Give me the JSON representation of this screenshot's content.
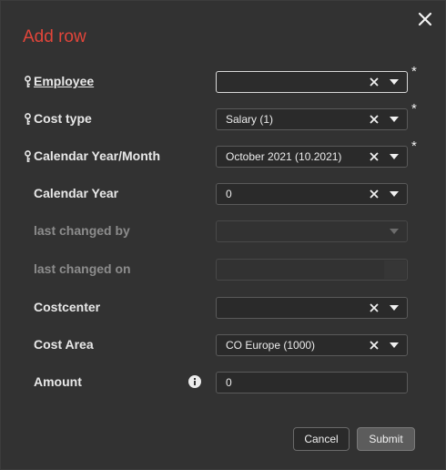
{
  "dialog": {
    "title": "Add row",
    "close_label": "×"
  },
  "fields": {
    "employee": {
      "label": "Employee",
      "value": "",
      "required": "*"
    },
    "cost_type": {
      "label": "Cost type",
      "value": "Salary (1)",
      "required": "*"
    },
    "calendar_year_month": {
      "label": "Calendar Year/Month",
      "value": "October 2021 (10.2021)",
      "required": "*"
    },
    "calendar_year": {
      "label": "Calendar Year",
      "value": "0"
    },
    "last_changed_by": {
      "label": "last changed by",
      "value": ""
    },
    "last_changed_on": {
      "label": "last changed on",
      "value": ""
    },
    "costcenter": {
      "label": "Costcenter",
      "value": ""
    },
    "cost_area": {
      "label": "Cost Area",
      "value": "CO Europe (1000)"
    },
    "amount": {
      "label": "Amount",
      "value": "0"
    }
  },
  "buttons": {
    "cancel": "Cancel",
    "submit": "Submit"
  },
  "colors": {
    "title": "#e2453a",
    "background": "#323232",
    "field": "#2a2a2a"
  },
  "icons": {
    "key": "key-icon",
    "clear": "clear-x-icon",
    "dropdown": "chevron-down-icon",
    "info": "info-icon",
    "close": "close-icon"
  }
}
